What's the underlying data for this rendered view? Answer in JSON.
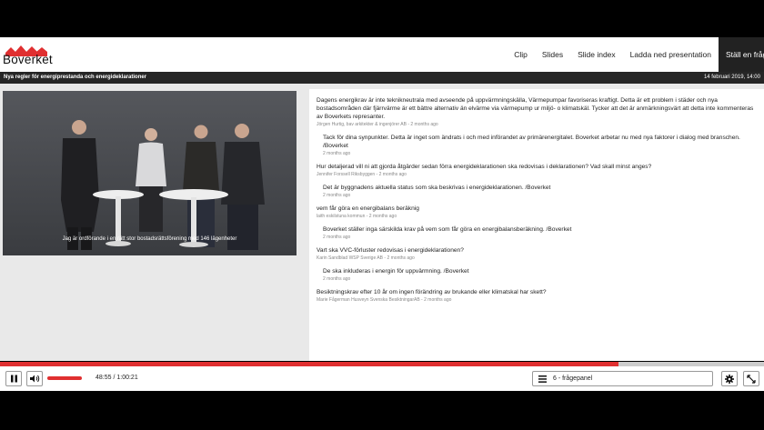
{
  "brand": {
    "name": "Boverket",
    "accent": "#e02f30"
  },
  "nav": [
    {
      "label": "Clip"
    },
    {
      "label": "Slides"
    },
    {
      "label": "Slide index"
    },
    {
      "label": "Ladda ned presentation"
    },
    {
      "label": "Ställ en fråga",
      "active": true
    }
  ],
  "titlebar": {
    "title": "Nya regler för energiprestanda och energideklarationer",
    "date": "14 februari 2019, 14:00"
  },
  "video": {
    "subtitle": "Jag är ordförande i en rätt stor bostadsrättsförening med 146 lägenheter"
  },
  "qa": [
    {
      "type": "q",
      "text": "Dagens energikrav är inte teknikneutrala med avseende på uppvärmningskälla, Värmepumpar favoriseras kraftigt. Detta är ett problem i städer och nya bostadsområden där fjärrvärme är ett bättre alternativ än elvärme via värmepump ur miljö- o klimatskäl. Tycker att det är anmärkningsvärt att detta inte kommenteras av Boverkets represanter.",
      "meta": "Jörgen Hurtig, bav arkitekter & ingenjörer AB - 2 months ago"
    },
    {
      "type": "a",
      "text": "Tack för dina synpunkter. Detta är inget som ändrats i och med införandet av primärenergitalet. Boverket arbetar nu med nya faktorer i dialog med branschen. /Boverket",
      "meta": "2 months ago"
    },
    {
      "type": "q",
      "text": "Hur detaljerad vill ni att gjorda åtgärder sedan förra energideklarationen ska redovisas i deklarationen? Vad skall minst anges?",
      "meta": "Jennifer Forssell Riksbyggen - 2 months ago"
    },
    {
      "type": "a",
      "text": "Det är byggnadens aktuella status som ska beskrivas i energideklarationen. /Boverket",
      "meta": "2 months ago"
    },
    {
      "type": "q",
      "text": "vem får göra en energibalans beräknig",
      "meta": "laith eskilstuna kommun - 2 months ago"
    },
    {
      "type": "a",
      "text": "Boverket ställer inga särskilda krav på vem som får göra en energibalansberäkning. /Boverket",
      "meta": "2 months ago"
    },
    {
      "type": "q",
      "text": "Vart ska VVC-förluster redovisas i energideklarationen?",
      "meta": "Karin Sandblad WSP Sverige AB - 2 months ago"
    },
    {
      "type": "a",
      "text": "De ska inkluderas i energin för uppvärmning. /Boverket",
      "meta": "2 months ago"
    },
    {
      "type": "q",
      "text": "Besiktningskrav efter 10 år om ingen förändring av brukande eller klimatskal har skett?",
      "meta": "Marie Fågerman Husveyn Svenska BesiktningarAB - 2 months ago"
    }
  ],
  "player": {
    "time": "48:55 / 1:00:21",
    "progress": 0.81,
    "volume": 1.0,
    "chapter": "6 - frågepanel",
    "icons": [
      "pause-icon",
      "volume-icon",
      "list-icon",
      "gear-icon",
      "fullscreen-icon"
    ]
  }
}
